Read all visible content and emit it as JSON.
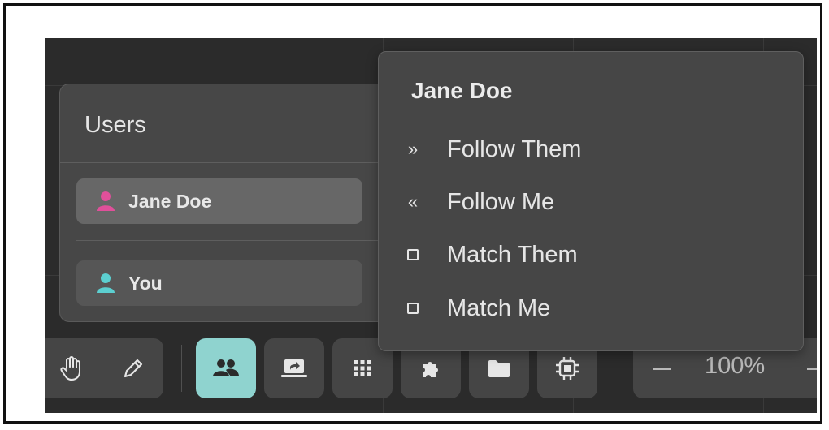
{
  "users_panel": {
    "title": "Users",
    "users": [
      {
        "name": "Jane Doe",
        "icon": "person-icon",
        "color": "#e0509a",
        "selected": true
      },
      {
        "name": "You",
        "icon": "person-icon",
        "color": "#5ccfd0",
        "selected": false
      }
    ]
  },
  "context_menu": {
    "title": "Jane Doe",
    "items": [
      {
        "glyph": "»",
        "label": "Follow Them",
        "icon": "follow-them-icon"
      },
      {
        "glyph": "«",
        "label": "Follow Me",
        "icon": "follow-me-icon"
      },
      {
        "glyph": "",
        "label": "Match Them",
        "icon": "checkbox-icon"
      },
      {
        "glyph": "",
        "label": "Match Me",
        "icon": "checkbox-icon"
      }
    ]
  },
  "toolbar": {
    "tools": [
      {
        "name": "hand-icon",
        "active": false
      },
      {
        "name": "pencil-icon",
        "active": false
      },
      {
        "name": "users-icon",
        "active": true
      },
      {
        "name": "share-screen-icon",
        "active": false
      },
      {
        "name": "grid-icon",
        "active": false
      },
      {
        "name": "puzzle-icon",
        "active": false
      },
      {
        "name": "folder-icon",
        "active": false
      },
      {
        "name": "chip-icon",
        "active": false
      }
    ],
    "zoom_level": "100%",
    "active_color": "#8fd3cf"
  }
}
